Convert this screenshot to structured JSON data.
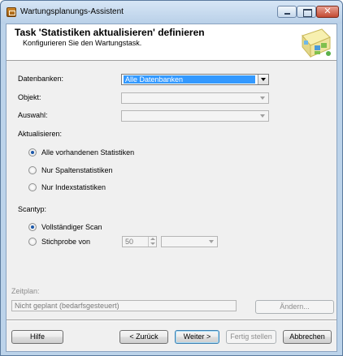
{
  "window": {
    "title": "Wartungsplanungs-Assistent",
    "caption_close": "✕",
    "accent_color": "#3399ff"
  },
  "header": {
    "title": "Task 'Statistiken aktualisieren' definieren",
    "subtitle": "Konfigurieren Sie den Wartungstask."
  },
  "form": {
    "datenbanken_label": "Datenbanken:",
    "datenbanken_value": "Alle Datenbanken",
    "objekt_label": "Objekt:",
    "objekt_value": "",
    "auswahl_label": "Auswahl:",
    "auswahl_value": ""
  },
  "update": {
    "label": "Aktualisieren:",
    "options": [
      {
        "label": "Alle vorhandenen Statistiken",
        "checked": true
      },
      {
        "label": "Nur Spaltenstatistiken",
        "checked": false
      },
      {
        "label": "Nur Indexstatistiken",
        "checked": false
      }
    ]
  },
  "scan": {
    "label": "Scantyp:",
    "options": [
      {
        "label": "Vollständiger Scan",
        "checked": true
      },
      {
        "label": "Stichprobe von",
        "checked": false
      }
    ],
    "sample_value": "50",
    "sample_unit": ""
  },
  "schedule": {
    "label": "Zeitplan:",
    "value": "Nicht geplant (bedarfsgesteuert)",
    "change_button": "Ändern..."
  },
  "footer": {
    "help": "Hilfe",
    "back": "< Zurück",
    "next": "Weiter >",
    "finish": "Fertig stellen",
    "cancel": "Abbrechen"
  }
}
